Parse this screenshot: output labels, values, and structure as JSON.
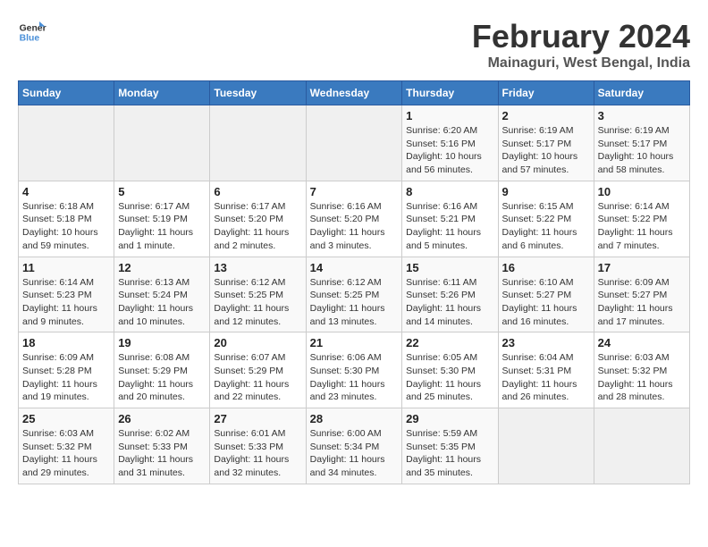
{
  "logo": {
    "line1": "General",
    "line2": "Blue"
  },
  "title": "February 2024",
  "subtitle": "Mainaguri, West Bengal, India",
  "days_of_week": [
    "Sunday",
    "Monday",
    "Tuesday",
    "Wednesday",
    "Thursday",
    "Friday",
    "Saturday"
  ],
  "weeks": [
    [
      {
        "day": "",
        "info": ""
      },
      {
        "day": "",
        "info": ""
      },
      {
        "day": "",
        "info": ""
      },
      {
        "day": "",
        "info": ""
      },
      {
        "day": "1",
        "info": "Sunrise: 6:20 AM\nSunset: 5:16 PM\nDaylight: 10 hours\nand 56 minutes."
      },
      {
        "day": "2",
        "info": "Sunrise: 6:19 AM\nSunset: 5:17 PM\nDaylight: 10 hours\nand 57 minutes."
      },
      {
        "day": "3",
        "info": "Sunrise: 6:19 AM\nSunset: 5:17 PM\nDaylight: 10 hours\nand 58 minutes."
      }
    ],
    [
      {
        "day": "4",
        "info": "Sunrise: 6:18 AM\nSunset: 5:18 PM\nDaylight: 10 hours\nand 59 minutes."
      },
      {
        "day": "5",
        "info": "Sunrise: 6:17 AM\nSunset: 5:19 PM\nDaylight: 11 hours\nand 1 minute."
      },
      {
        "day": "6",
        "info": "Sunrise: 6:17 AM\nSunset: 5:20 PM\nDaylight: 11 hours\nand 2 minutes."
      },
      {
        "day": "7",
        "info": "Sunrise: 6:16 AM\nSunset: 5:20 PM\nDaylight: 11 hours\nand 3 minutes."
      },
      {
        "day": "8",
        "info": "Sunrise: 6:16 AM\nSunset: 5:21 PM\nDaylight: 11 hours\nand 5 minutes."
      },
      {
        "day": "9",
        "info": "Sunrise: 6:15 AM\nSunset: 5:22 PM\nDaylight: 11 hours\nand 6 minutes."
      },
      {
        "day": "10",
        "info": "Sunrise: 6:14 AM\nSunset: 5:22 PM\nDaylight: 11 hours\nand 7 minutes."
      }
    ],
    [
      {
        "day": "11",
        "info": "Sunrise: 6:14 AM\nSunset: 5:23 PM\nDaylight: 11 hours\nand 9 minutes."
      },
      {
        "day": "12",
        "info": "Sunrise: 6:13 AM\nSunset: 5:24 PM\nDaylight: 11 hours\nand 10 minutes."
      },
      {
        "day": "13",
        "info": "Sunrise: 6:12 AM\nSunset: 5:25 PM\nDaylight: 11 hours\nand 12 minutes."
      },
      {
        "day": "14",
        "info": "Sunrise: 6:12 AM\nSunset: 5:25 PM\nDaylight: 11 hours\nand 13 minutes."
      },
      {
        "day": "15",
        "info": "Sunrise: 6:11 AM\nSunset: 5:26 PM\nDaylight: 11 hours\nand 14 minutes."
      },
      {
        "day": "16",
        "info": "Sunrise: 6:10 AM\nSunset: 5:27 PM\nDaylight: 11 hours\nand 16 minutes."
      },
      {
        "day": "17",
        "info": "Sunrise: 6:09 AM\nSunset: 5:27 PM\nDaylight: 11 hours\nand 17 minutes."
      }
    ],
    [
      {
        "day": "18",
        "info": "Sunrise: 6:09 AM\nSunset: 5:28 PM\nDaylight: 11 hours\nand 19 minutes."
      },
      {
        "day": "19",
        "info": "Sunrise: 6:08 AM\nSunset: 5:29 PM\nDaylight: 11 hours\nand 20 minutes."
      },
      {
        "day": "20",
        "info": "Sunrise: 6:07 AM\nSunset: 5:29 PM\nDaylight: 11 hours\nand 22 minutes."
      },
      {
        "day": "21",
        "info": "Sunrise: 6:06 AM\nSunset: 5:30 PM\nDaylight: 11 hours\nand 23 minutes."
      },
      {
        "day": "22",
        "info": "Sunrise: 6:05 AM\nSunset: 5:30 PM\nDaylight: 11 hours\nand 25 minutes."
      },
      {
        "day": "23",
        "info": "Sunrise: 6:04 AM\nSunset: 5:31 PM\nDaylight: 11 hours\nand 26 minutes."
      },
      {
        "day": "24",
        "info": "Sunrise: 6:03 AM\nSunset: 5:32 PM\nDaylight: 11 hours\nand 28 minutes."
      }
    ],
    [
      {
        "day": "25",
        "info": "Sunrise: 6:03 AM\nSunset: 5:32 PM\nDaylight: 11 hours\nand 29 minutes."
      },
      {
        "day": "26",
        "info": "Sunrise: 6:02 AM\nSunset: 5:33 PM\nDaylight: 11 hours\nand 31 minutes."
      },
      {
        "day": "27",
        "info": "Sunrise: 6:01 AM\nSunset: 5:33 PM\nDaylight: 11 hours\nand 32 minutes."
      },
      {
        "day": "28",
        "info": "Sunrise: 6:00 AM\nSunset: 5:34 PM\nDaylight: 11 hours\nand 34 minutes."
      },
      {
        "day": "29",
        "info": "Sunrise: 5:59 AM\nSunset: 5:35 PM\nDaylight: 11 hours\nand 35 minutes."
      },
      {
        "day": "",
        "info": ""
      },
      {
        "day": "",
        "info": ""
      }
    ]
  ]
}
